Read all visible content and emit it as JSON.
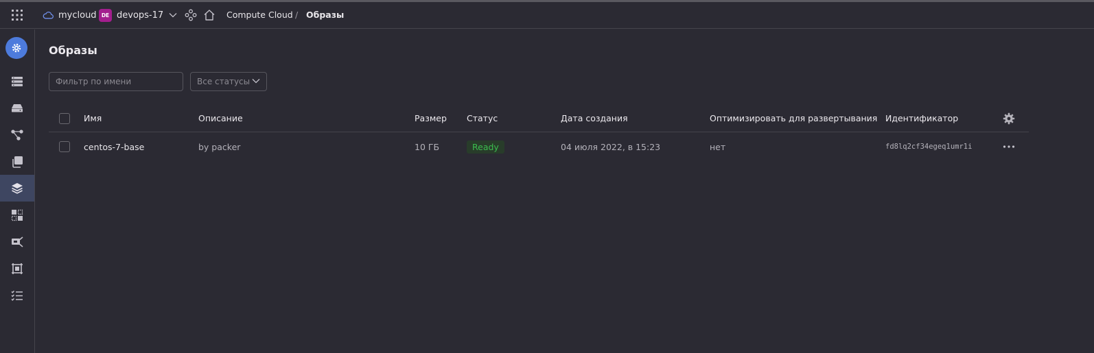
{
  "header": {
    "cloud_name": "mycloud",
    "folder_badge": "DE",
    "folder_name": "devops-17",
    "breadcrumb": {
      "service": "Compute Cloud",
      "separator": "/",
      "current": "Образы"
    }
  },
  "page": {
    "title": "Образы"
  },
  "filters": {
    "name_placeholder": "Фильтр по имени",
    "status_value": "Все статусы"
  },
  "table": {
    "columns": {
      "name": "Имя",
      "description": "Описание",
      "size": "Размер",
      "status": "Статус",
      "created": "Дата создания",
      "optimize": "Оптимизировать для развертывания",
      "id": "Идентификатор"
    },
    "rows": [
      {
        "name": "centos-7-base",
        "description": "by packer",
        "size": "10 ГБ",
        "status": "Ready",
        "created": "04 июля 2022, в 15:23",
        "optimize": "нет",
        "id": "fd8lq2cf34egeq1umr1i"
      }
    ]
  },
  "colors": {
    "accent": "#4d7bdc",
    "folder_badge": "#a31e8e",
    "status_ready": "#3bbd4e",
    "background": "#2b2a33",
    "sidebar_active": "#3e4661"
  },
  "icons": {
    "apps": "grid-icon",
    "cloud": "cloud-icon",
    "folder_chevron": "chevron-down-icon",
    "services": "nodes-icon",
    "home": "home-icon",
    "service": "compute-gear-icon",
    "sidebar": [
      "server-icon",
      "disk-icon",
      "network-icon",
      "snapshots-icon",
      "images-icon",
      "placement-icon",
      "gpu-icon",
      "instance-group-icon",
      "operations-icon"
    ],
    "column_settings": "gear-icon",
    "row_actions": "more-icon"
  }
}
